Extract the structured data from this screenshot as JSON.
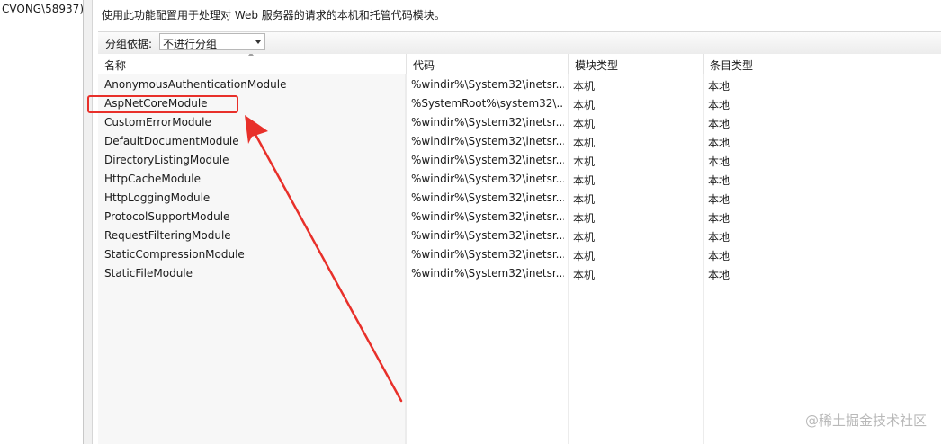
{
  "tree": {
    "node_label": "CVONG\\58937)"
  },
  "description": "使用此功能配置用于处理对 Web 服务器的请求的本机和托管代码模块。",
  "group_by": {
    "label": "分组依据:",
    "value": "不进行分组"
  },
  "columns": {
    "name": "名称",
    "code": "代码",
    "module_type": "模块类型",
    "entry_type": "条目类型"
  },
  "modules": [
    {
      "name": "AnonymousAuthenticationModule",
      "code": "%windir%\\System32\\inetsr...",
      "module_type": "本机",
      "entry_type": "本地"
    },
    {
      "name": "AspNetCoreModule",
      "code": "%SystemRoot%\\system32\\...",
      "module_type": "本机",
      "entry_type": "本地"
    },
    {
      "name": "CustomErrorModule",
      "code": "%windir%\\System32\\inetsr...",
      "module_type": "本机",
      "entry_type": "本地"
    },
    {
      "name": "DefaultDocumentModule",
      "code": "%windir%\\System32\\inetsr...",
      "module_type": "本机",
      "entry_type": "本地"
    },
    {
      "name": "DirectoryListingModule",
      "code": "%windir%\\System32\\inetsr...",
      "module_type": "本机",
      "entry_type": "本地"
    },
    {
      "name": "HttpCacheModule",
      "code": "%windir%\\System32\\inetsr...",
      "module_type": "本机",
      "entry_type": "本地"
    },
    {
      "name": "HttpLoggingModule",
      "code": "%windir%\\System32\\inetsr...",
      "module_type": "本机",
      "entry_type": "本地"
    },
    {
      "name": "ProtocolSupportModule",
      "code": "%windir%\\System32\\inetsr...",
      "module_type": "本机",
      "entry_type": "本地"
    },
    {
      "name": "RequestFilteringModule",
      "code": "%windir%\\System32\\inetsr...",
      "module_type": "本机",
      "entry_type": "本地"
    },
    {
      "name": "StaticCompressionModule",
      "code": "%windir%\\System32\\inetsr...",
      "module_type": "本机",
      "entry_type": "本地"
    },
    {
      "name": "StaticFileModule",
      "code": "%windir%\\System32\\inetsr...",
      "module_type": "本机",
      "entry_type": "本地"
    }
  ],
  "annotation": {
    "color": "#e8302a",
    "highlighted_module": "AspNetCoreModule"
  },
  "watermark": "@稀土掘金技术社区"
}
